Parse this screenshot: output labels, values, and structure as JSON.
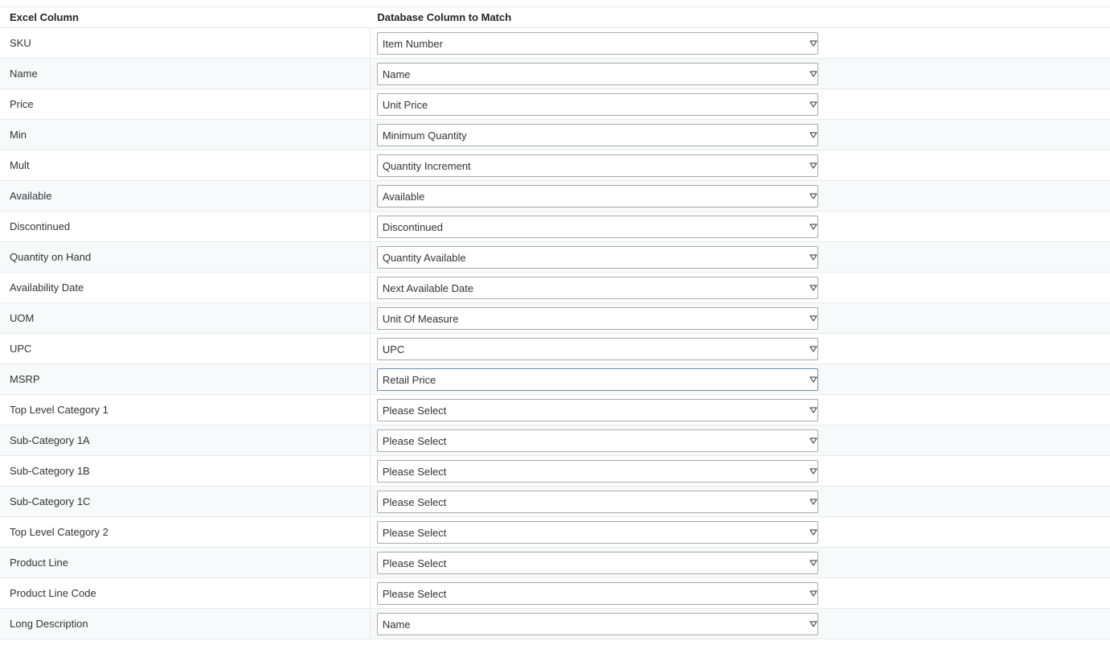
{
  "headers": {
    "excel_column": "Excel Column",
    "database_column": "Database Column to Match"
  },
  "colors": {
    "check": "#1f8a2e",
    "cross": "#e02020"
  },
  "rows": [
    {
      "excel": "SKU",
      "database": "Item Number",
      "status": "check-icon"
    },
    {
      "excel": "Name",
      "database": "Name",
      "status": "check-icon"
    },
    {
      "excel": "Price",
      "database": "Unit Price",
      "status": "check-icon"
    },
    {
      "excel": "Min",
      "database": "Minimum Quantity",
      "status": "check-icon"
    },
    {
      "excel": "Mult",
      "database": "Quantity Increment",
      "status": "check-icon"
    },
    {
      "excel": "Available",
      "database": "Available",
      "status": "check-icon"
    },
    {
      "excel": "Discontinued",
      "database": "Discontinued",
      "status": "check-icon"
    },
    {
      "excel": "Quantity on Hand",
      "database": "Quantity Available",
      "status": "check-icon"
    },
    {
      "excel": "Availability Date",
      "database": "Next Available Date",
      "status": "check-icon"
    },
    {
      "excel": "UOM",
      "database": "Unit Of Measure",
      "status": "check-icon"
    },
    {
      "excel": "UPC",
      "database": "UPC",
      "status": "check-icon"
    },
    {
      "excel": "MSRP",
      "database": "Retail Price",
      "status": "check-icon",
      "focused": true
    },
    {
      "excel": "Top Level Category 1",
      "database": "Please Select",
      "status": "cross-icon"
    },
    {
      "excel": "Sub-Category 1A",
      "database": "Please Select",
      "status": "cross-icon"
    },
    {
      "excel": "Sub-Category 1B",
      "database": "Please Select",
      "status": "cross-icon"
    },
    {
      "excel": "Sub-Category 1C",
      "database": "Please Select",
      "status": "cross-icon"
    },
    {
      "excel": "Top Level Category 2",
      "database": "Please Select",
      "status": "cross-icon"
    },
    {
      "excel": "Product Line",
      "database": "Please Select",
      "status": "cross-icon"
    },
    {
      "excel": "Product Line Code",
      "database": "Please Select",
      "status": "cross-icon"
    },
    {
      "excel": "Long Description",
      "database": "Name",
      "status": "check-icon"
    }
  ]
}
